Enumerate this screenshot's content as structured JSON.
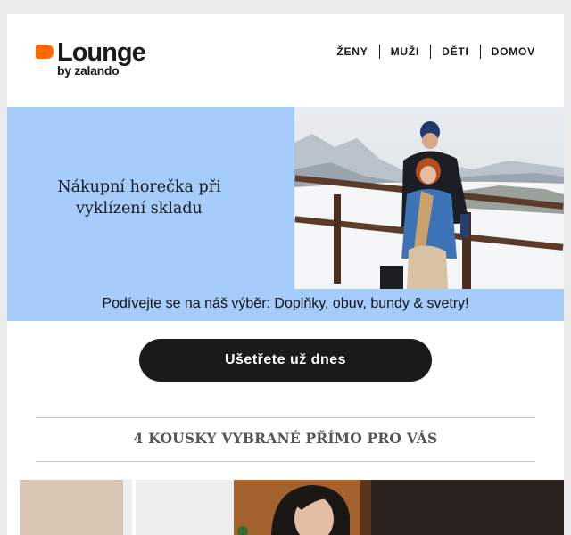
{
  "brand": {
    "name": "Lounge",
    "sub": "by zalando",
    "accent_color": "#ff6900"
  },
  "nav": {
    "items": [
      {
        "label": "ŽENY"
      },
      {
        "label": "MUŽI"
      },
      {
        "label": "DĚTI"
      },
      {
        "label": "DOMOV"
      }
    ]
  },
  "hero": {
    "title": "Nákupní horečka při vyklízení skladu",
    "subtitle": "Podívejte se na náš výběr: Doplňky, obuv, bundy & svetry!",
    "background_color": "#a6ccfb"
  },
  "cta": {
    "label": "Ušetřete už dnes"
  },
  "section": {
    "title": "4 KOUSKY VYBRANÉ PŘÍMO PRO VÁS"
  }
}
